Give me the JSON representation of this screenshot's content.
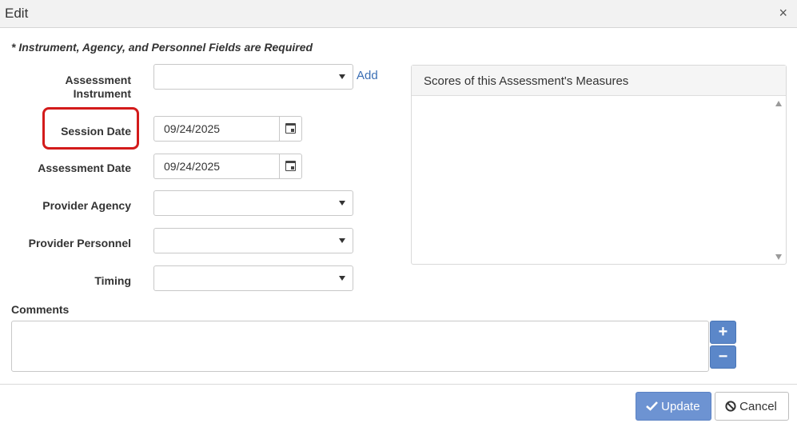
{
  "dialog": {
    "title": "Edit",
    "close_glyph": "×"
  },
  "required_note": "* Instrument, Agency, and Personnel Fields are Required",
  "fields": {
    "assessment_instrument": {
      "label_line1": "Assessment",
      "label_line2": "Instrument",
      "value": ""
    },
    "add_link": "Add",
    "session_date": {
      "label": "Session Date",
      "value": "09/24/2025"
    },
    "assessment_date": {
      "label": "Assessment Date",
      "value": "09/24/2025"
    },
    "provider_agency": {
      "label": "Provider Agency",
      "value": ""
    },
    "provider_personnel": {
      "label": "Provider Personnel",
      "value": ""
    },
    "timing": {
      "label": "Timing",
      "value": ""
    }
  },
  "scores_panel": {
    "title": "Scores of this Assessment's Measures"
  },
  "comments": {
    "label": "Comments",
    "value": "",
    "add_glyph": "+",
    "remove_glyph": "−"
  },
  "footer": {
    "update_label": "Update",
    "cancel_label": "Cancel"
  },
  "colors": {
    "highlight": "#d31b1b",
    "primary": "#6d93d2",
    "link": "#3a6eb4"
  },
  "icons": [
    "close-icon",
    "chevron-down-icon",
    "calendar-icon",
    "check-icon",
    "ban-icon",
    "scroll-up-icon",
    "scroll-down-icon"
  ]
}
